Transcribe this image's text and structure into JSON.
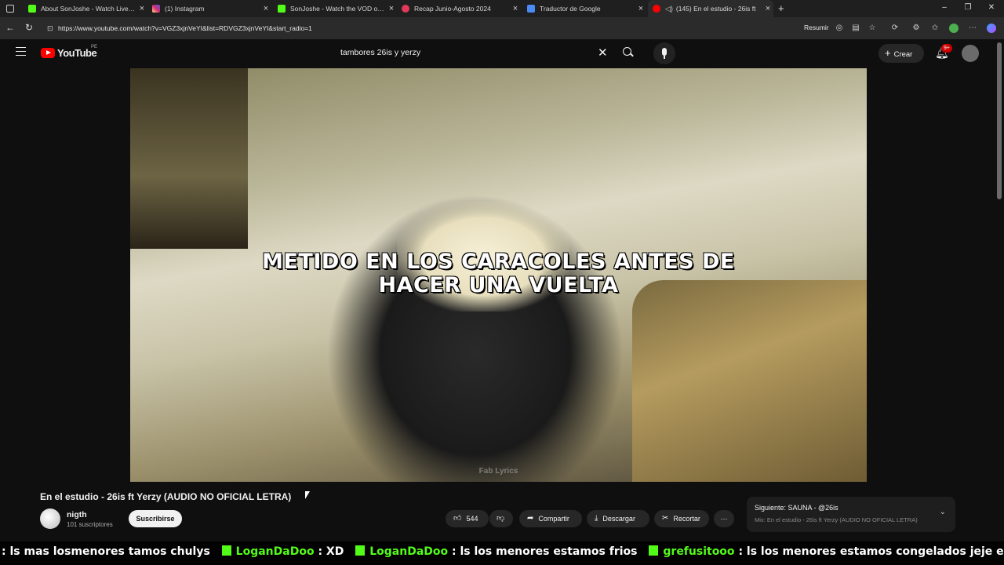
{
  "browser": {
    "tabs": [
      {
        "label": "About SonJoshe - Watch Live on",
        "favicon_color": "#53fc18",
        "favicon": "kick-icon"
      },
      {
        "label": "(1) Instagram",
        "favicon_color": "#d62976",
        "favicon": "instagram-icon"
      },
      {
        "label": "SonJoshe - Watch the VOD on K",
        "favicon_color": "#53fc18",
        "favicon": "kick-icon"
      },
      {
        "label": "Recap Junio-Agosto 2024",
        "favicon_color": "#e03a5a",
        "favicon": "recap-icon"
      },
      {
        "label": "Traductor de Google",
        "favicon_color": "#4a8af4",
        "favicon": "translate-icon"
      },
      {
        "label": "(145) En el estudio - 26is ft",
        "favicon_color": "#ff0000",
        "favicon": "youtube-icon"
      }
    ],
    "url": "https://www.youtube.com/watch?v=VGZ3xjnVeYI&list=RDVGZ3xjnVeYI&start_radio=1",
    "resumir_label": "Resumir"
  },
  "youtube": {
    "logo_text": "YouTube",
    "country_code": "PE",
    "search_query": "tambores 26is y yerzy",
    "create_label": "Crear",
    "notifications_badge": "9+"
  },
  "video": {
    "lyric_line1": "METIDO EN LOS CARACOLES ANTES DE",
    "lyric_line2": "HACER UNA VUELTA",
    "watermark": "Fab Lyrics"
  },
  "details": {
    "title": "En el estudio - 26is ft Yerzy (AUDIO NO OFICIAL LETRA)",
    "channel_name": "nigth",
    "subscribers": "101 suscriptores",
    "subscribe_label": "Suscribirse",
    "likes": "544",
    "share_label": "Compartir",
    "download_label": "Descargar",
    "clip_label": "Recortar",
    "next_title": "Siguiente: SAUNA - @26is",
    "next_subtitle": "Mix: En el estudio - 26is ft Yerzy (AUDIO NO OFICIAL LETRA)"
  },
  "chat": {
    "msg0": ": ls mas losmenores tamos chulys",
    "user1": "LoganDaDoo",
    "msg1": ": XD",
    "user2": "LoganDaDoo",
    "msg2": ": ls los menores estamos frios",
    "user3": "grefusitooo",
    "msg3": ": ls los menores estamos congelados jeje ekisde"
  }
}
